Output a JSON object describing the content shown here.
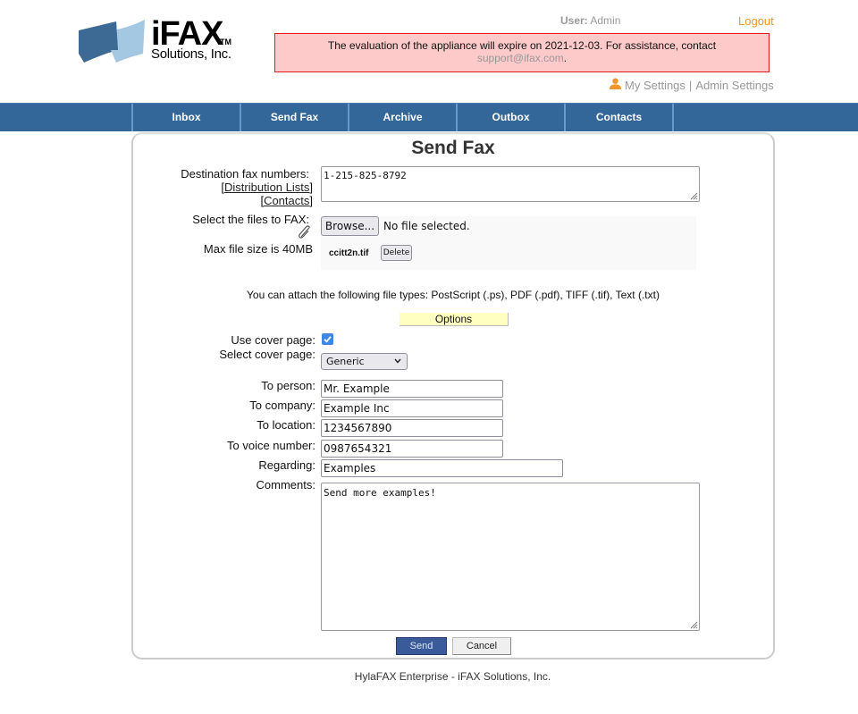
{
  "header": {
    "logo": {
      "name": "iFAX",
      "tm": "TM",
      "subtitle": "Solutions, Inc."
    },
    "user_label": "User:",
    "user_name": "Admin",
    "logout_label": "Logout",
    "alert": {
      "message": "The evaluation of the appliance will expire on 2021-12-03. For assistance, contact",
      "email": "support@ifax.com",
      "suffix": "."
    },
    "my_settings_label": "My Settings",
    "separator": "|",
    "admin_settings_label": "Admin Settings",
    "colors": {
      "logout": "#f0962a",
      "alert_bg": "#fdc9c9",
      "alert_border": "#e21b1b"
    }
  },
  "navbar": {
    "items": [
      {
        "label": "Inbox"
      },
      {
        "label": "Send Fax"
      },
      {
        "label": "Archive"
      },
      {
        "label": "Outbox"
      },
      {
        "label": "Contacts"
      }
    ],
    "color": "#336699"
  },
  "form": {
    "title": "Send Fax",
    "destination": {
      "label": "Destination fax numbers:",
      "distribution_lists_link": "Distribution Lists",
      "contacts_link": "Contacts",
      "value": "1-215-825-8792"
    },
    "files": {
      "label": "Select the files to FAX:",
      "max_size_label": "Max file size is 40MB",
      "browse_label": "Browse...",
      "no_file_text": "No file selected.",
      "attached": [
        {
          "name": "ccitt2n.tif",
          "delete_label": "Delete"
        }
      ],
      "filetypes_text": "You can attach the following file types: PostScript (.ps), PDF (.pdf), TIFF (.tif), Text (.txt)"
    },
    "options_label": "Options",
    "use_cover_page": {
      "label": "Use cover page:",
      "checked": true
    },
    "select_cover_page": {
      "label": "Select cover page:",
      "value": "Generic"
    },
    "to_person": {
      "label": "To person:",
      "value": "Mr. Example"
    },
    "to_company": {
      "label": "To company:",
      "value": "Example Inc"
    },
    "to_location": {
      "label": "To location:",
      "value": "1234567890"
    },
    "to_voice": {
      "label": "To voice number:",
      "value": "0987654321"
    },
    "regarding": {
      "label": "Regarding:",
      "value": "Examples"
    },
    "comments": {
      "label": "Comments:",
      "value": "Send more examples!"
    },
    "send_label": "Send",
    "cancel_label": "Cancel"
  },
  "footer": {
    "text": "HylaFAX Enterprise - iFAX Solutions, Inc."
  }
}
